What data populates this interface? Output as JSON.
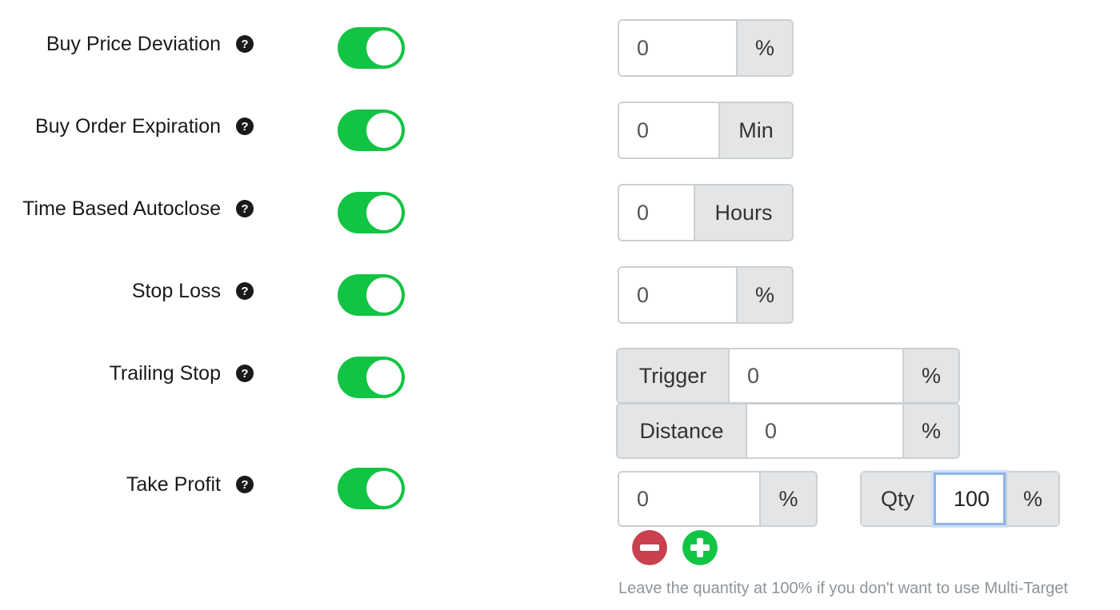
{
  "rows": [
    {
      "label": "Buy Price Deviation",
      "value": "0",
      "unit": "%"
    },
    {
      "label": "Buy Order Expiration",
      "value": "0",
      "unit": "Min"
    },
    {
      "label": "Time Based Autoclose",
      "value": "0",
      "unit": "Hours"
    },
    {
      "label": "Stop Loss",
      "value": "0",
      "unit": "%"
    },
    {
      "label": "Trailing Stop",
      "trigger_label": "Trigger",
      "trigger_value": "0",
      "trigger_unit": "%",
      "distance_label": "Distance",
      "distance_value": "0",
      "distance_unit": "%"
    },
    {
      "label": "Take Profit",
      "value": "0",
      "unit": "%",
      "qty_label": "Qty",
      "qty_value": "100",
      "qty_unit": "%"
    }
  ],
  "toggles_on": true,
  "hint": "Leave the quantity at 100% if you don't want to use Multi-Target",
  "colors": {
    "toggle_on": "#12c443",
    "remove": "#c9404f",
    "add": "#12c443",
    "addon_bg": "#e4e5e6"
  },
  "icons": {
    "help": "question-circle-icon",
    "remove": "minus-circle-icon",
    "add": "plus-circle-icon"
  }
}
